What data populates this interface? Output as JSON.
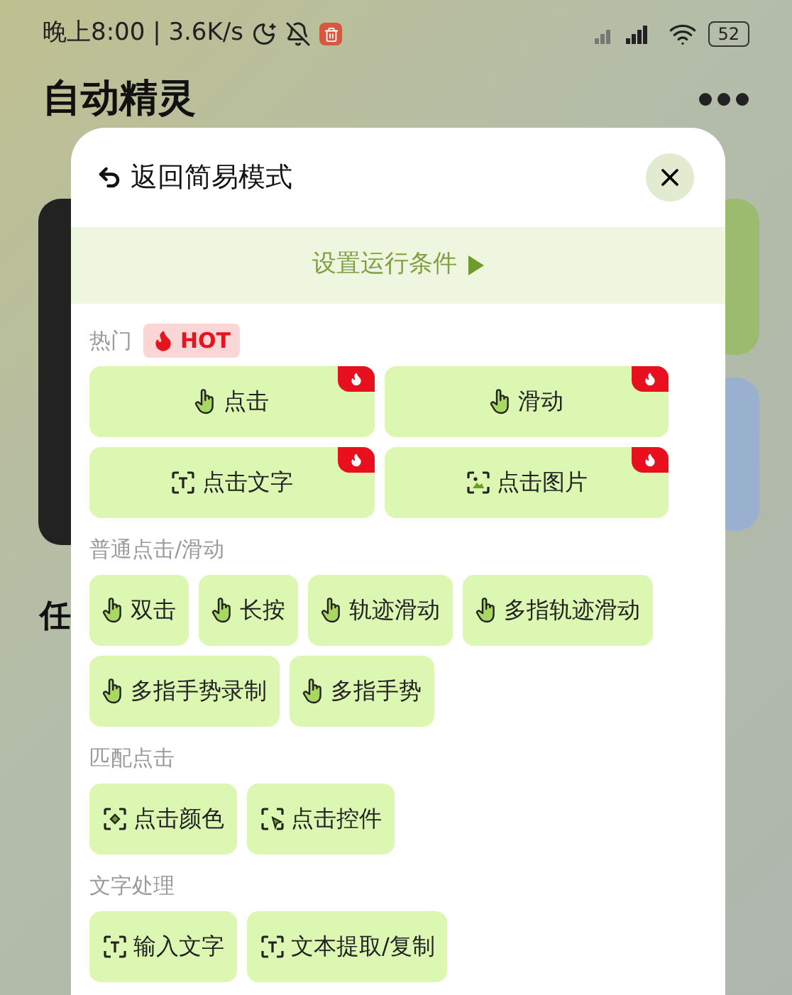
{
  "status_bar": {
    "time": "晚上8:00 | 3.6K/s",
    "battery": "52"
  },
  "app": {
    "title": "自动精灵",
    "section_label": "任"
  },
  "dialog": {
    "back_label": "返回简易模式",
    "condition_label": "设置运行条件",
    "sections": [
      {
        "title": "热门",
        "badge": "HOT",
        "buttons": [
          {
            "label": "点击",
            "kind": "gesture",
            "hot": true
          },
          {
            "label": "滑动",
            "kind": "gesture",
            "hot": true
          },
          {
            "label": "点击文字",
            "kind": "scan-text",
            "hot": true
          },
          {
            "label": "点击图片",
            "kind": "scan-image",
            "hot": true
          }
        ]
      },
      {
        "title": "普通点击/滑动",
        "buttons": [
          {
            "label": "双击",
            "kind": "gesture",
            "hot": false
          },
          {
            "label": "长按",
            "kind": "gesture",
            "hot": false
          },
          {
            "label": "轨迹滑动",
            "kind": "gesture",
            "hot": false
          },
          {
            "label": "多指轨迹滑动",
            "kind": "gesture",
            "hot": false
          },
          {
            "label": "多指手势录制",
            "kind": "gesture",
            "hot": false
          },
          {
            "label": "多指手势",
            "kind": "gesture",
            "hot": false
          }
        ]
      },
      {
        "title": "匹配点击",
        "buttons": [
          {
            "label": "点击颜色",
            "kind": "scan-color",
            "hot": false
          },
          {
            "label": "点击控件",
            "kind": "scan-control",
            "hot": false
          }
        ]
      },
      {
        "title": "文字处理",
        "buttons": [
          {
            "label": "输入文字",
            "kind": "scan-text",
            "hot": false
          },
          {
            "label": "文本提取/复制",
            "kind": "scan-text",
            "hot": false
          }
        ]
      }
    ]
  }
}
